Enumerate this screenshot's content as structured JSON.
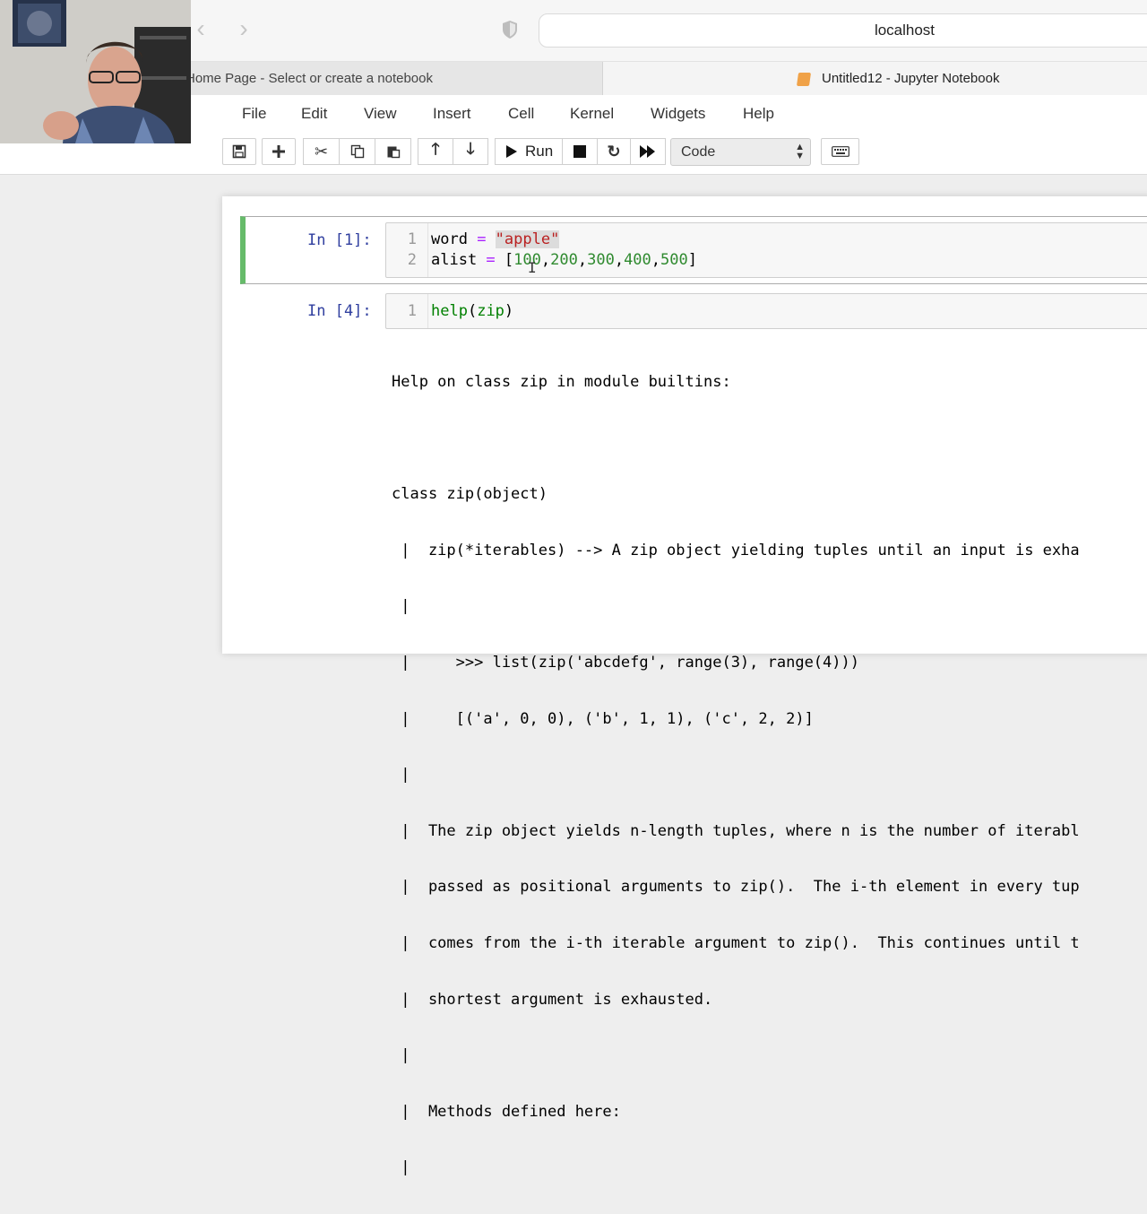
{
  "browser": {
    "address": "localhost",
    "tabs": [
      {
        "label": "Home Page - Select or create a notebook"
      },
      {
        "label": "Untitled12 - Jupyter Notebook"
      }
    ]
  },
  "menu": [
    "File",
    "Edit",
    "View",
    "Insert",
    "Cell",
    "Kernel",
    "Widgets",
    "Help"
  ],
  "toolbar": {
    "run_label": "Run",
    "cell_type": "Code",
    "icons": [
      "save-icon",
      "plus-icon",
      "scissors-icon",
      "copy-icon",
      "paste-icon",
      "arrow-up-icon",
      "arrow-down-icon",
      "play-icon",
      "stop-icon",
      "restart-icon",
      "fast-forward-icon",
      "keyboard-icon"
    ]
  },
  "cells": [
    {
      "prompt": "In [1]:",
      "lines": [
        {
          "num": "1",
          "parts": [
            "word",
            " = ",
            "\"apple\""
          ]
        },
        {
          "num": "2",
          "parts": [
            "alist",
            " = ",
            "[",
            "100",
            ",",
            "200",
            ",",
            "300",
            ",",
            "400",
            ",",
            "500",
            "]"
          ]
        }
      ]
    },
    {
      "prompt": "In [4]:",
      "lines": [
        {
          "num": "1",
          "parts": [
            "help",
            "(",
            "zip",
            ")"
          ]
        }
      ]
    }
  ],
  "output_lines": [
    "Help on class zip in module builtins:",
    "",
    "class zip(object)",
    " |  zip(*iterables) --> A zip object yielding tuples until an input is exha",
    " |",
    " |     >>> list(zip('abcdefg', range(3), range(4)))",
    " |     [('a', 0, 0), ('b', 1, 1), ('c', 2, 2)]",
    " |",
    " |  The zip object yields n-length tuples, where n is the number of iterabl",
    " |  passed as positional arguments to zip().  The i-th element in every tup",
    " |  comes from the i-th iterable argument to zip().  This continues until t",
    " |  shortest argument is exhausted.",
    " |",
    " |  Methods defined here:",
    " |"
  ],
  "colors": {
    "accent_green": "#66bb6a",
    "prompt_blue": "#303f9f",
    "string_red": "#ba2121",
    "number_green": "#2f8a2f"
  }
}
